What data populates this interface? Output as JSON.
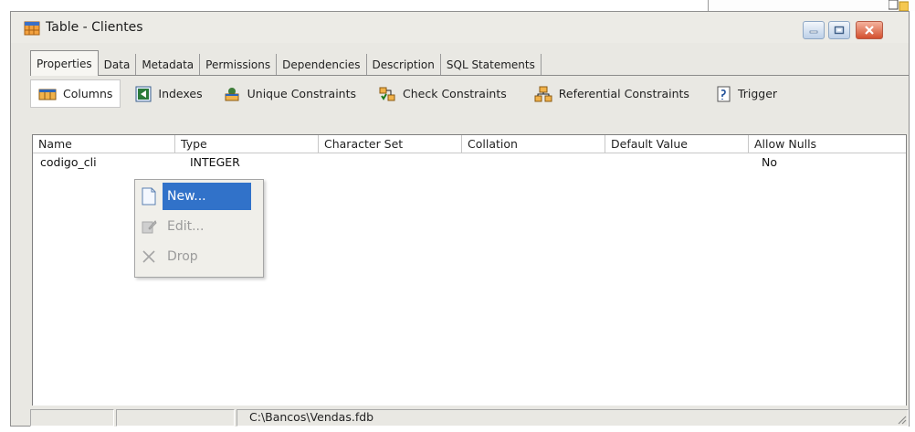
{
  "window": {
    "title": "Table - Clientes"
  },
  "tabs": [
    {
      "label": "Properties",
      "active": true
    },
    {
      "label": "Data"
    },
    {
      "label": "Metadata"
    },
    {
      "label": "Permissions"
    },
    {
      "label": "Dependencies"
    },
    {
      "label": "Description"
    },
    {
      "label": "SQL Statements"
    }
  ],
  "subtabs": [
    {
      "label": "Columns",
      "icon": "columns-icon",
      "active": true
    },
    {
      "label": "Indexes",
      "icon": "indexes-icon"
    },
    {
      "label": "Unique Constraints",
      "icon": "unique-constraints-icon"
    },
    {
      "label": "Check Constraints",
      "icon": "check-constraints-icon"
    },
    {
      "label": "Referential Constraints",
      "icon": "referential-constraints-icon"
    },
    {
      "label": "Trigger",
      "icon": "trigger-icon"
    }
  ],
  "grid": {
    "columns": [
      "Name",
      "Type",
      "Character Set",
      "Collation",
      "Default Value",
      "Allow Nulls"
    ],
    "rows": [
      {
        "name": "codigo_cli",
        "type": "INTEGER",
        "charset": "",
        "collation": "",
        "default": "",
        "allow_nulls": "No"
      }
    ]
  },
  "context_menu": {
    "items": [
      {
        "label": "New...",
        "icon": "new-document-icon",
        "enabled": true,
        "highlighted": true
      },
      {
        "label": "Edit...",
        "icon": "edit-icon",
        "enabled": false
      },
      {
        "label": "Drop",
        "icon": "drop-x-icon",
        "enabled": false
      }
    ]
  },
  "statusbar": {
    "path": "C:\\Bancos\\Vendas.fdb"
  },
  "colors": {
    "selection": "#3172c9",
    "window_bg": "#e9e8e3"
  }
}
